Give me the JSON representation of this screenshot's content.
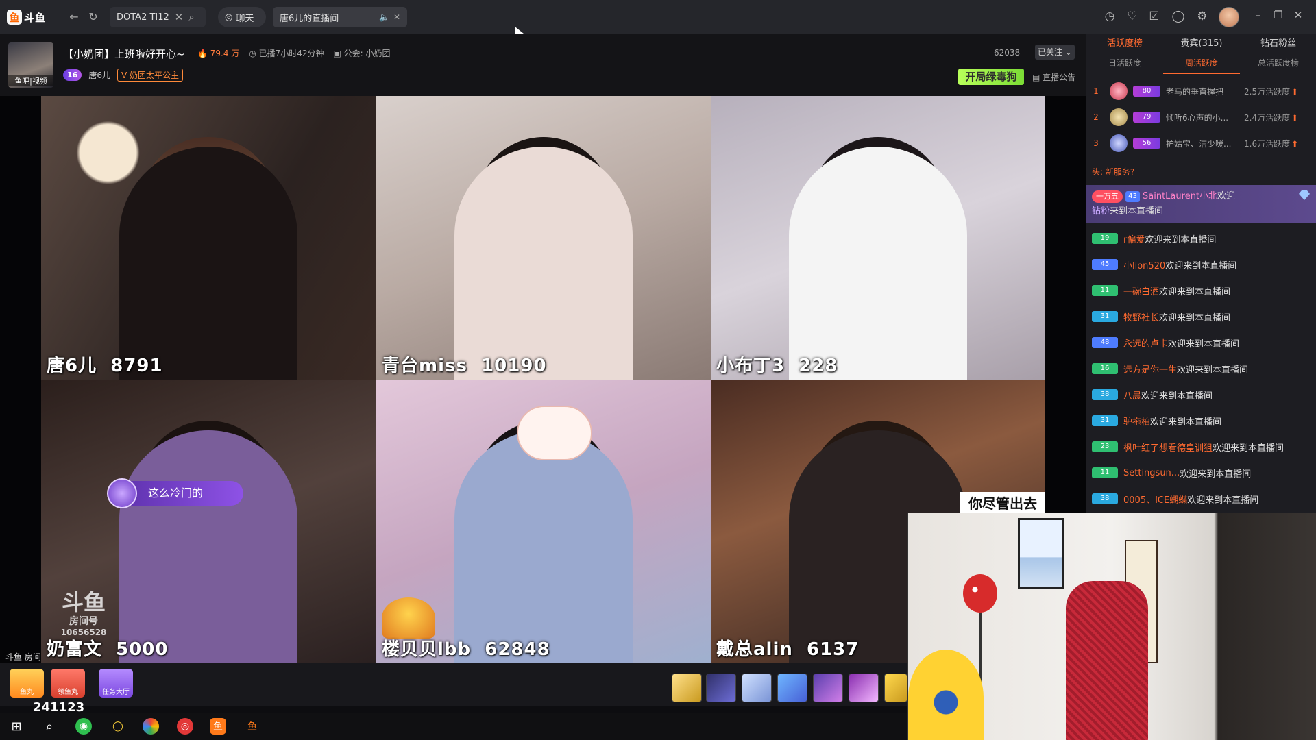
{
  "browser": {
    "logo_text": "斗鱼",
    "tabs": [
      {
        "label": "DOTA2 TI12"
      },
      {
        "label": "聊天"
      },
      {
        "label": "唐6儿的直播间"
      }
    ]
  },
  "room": {
    "avatar_caption": "鱼吧|视频",
    "title": "【小奶团】上班啦好开心~",
    "hot": "79.4 万",
    "duration": "已播7小时42分钟",
    "guild": "公会: 小奶团",
    "anchor_level": "16",
    "anchor_name": "唐6儿",
    "fan_badge": "奶团太平公主",
    "follow_count": "62038",
    "follow_button": "已关注",
    "event_banner": "开局绿毒狗",
    "announcement": "直播公告"
  },
  "streams": [
    {
      "name": "唐6儿",
      "score": "8791"
    },
    {
      "name": "青台miss",
      "score": "10190"
    },
    {
      "name": "小布丁3",
      "score": "228"
    },
    {
      "name": "奶富文",
      "score": "5000"
    },
    {
      "name": "楼贝贝lbb",
      "score": "62848"
    },
    {
      "name": "戴总alin",
      "score": "6137"
    }
  ],
  "overlays": {
    "bubble_text": "这么冷门的",
    "sub_caption": "你尽管出去",
    "watermark_brand": "斗鱼",
    "watermark_label": "房间号",
    "watermark_room": "10656528"
  },
  "side": {
    "tabs": [
      "活跃度榜",
      "贵宾(315)",
      "钻石粉丝"
    ],
    "active_tab": 0,
    "subtabs": [
      "日活跃度",
      "周活跃度",
      "总活跃度榜"
    ],
    "active_subtab": 1,
    "ranking": [
      {
        "rank": "1",
        "level": "80",
        "name": "老马的垂直握把",
        "value": "2.5万活跃度"
      },
      {
        "rank": "2",
        "level": "79",
        "name": "倾听6心声的小...",
        "value": "2.4万活跃度"
      },
      {
        "rank": "3",
        "level": "56",
        "name": "护姑宝、洁少嗳...",
        "value": "1.6万活跃度"
      }
    ],
    "system_tip": "头: 新服务?",
    "vip": {
      "rank_badge": "一万五",
      "level": "43",
      "user": "SaintLaurent小北",
      "text1": "欢迎",
      "role": "钻粉",
      "text2": "来到本直播间"
    },
    "welcome_suffix": "欢迎来到本直播间",
    "welcomes": [
      {
        "level": "19",
        "user": "r偏爱",
        "color": "#2fbf71"
      },
      {
        "level": "45",
        "user": "小lion520",
        "color": "#4e7cff"
      },
      {
        "level": "11",
        "user": "一碗白酒",
        "color": "#2fbf71"
      },
      {
        "level": "31",
        "user": "牧野社长",
        "color": "#2aa9e0"
      },
      {
        "level": "48",
        "user": "永远的卢卡",
        "color": "#4e7cff"
      },
      {
        "level": "16",
        "user": "远方是你一生",
        "color": "#2fbf71"
      },
      {
        "level": "38",
        "user": "八晨",
        "color": "#2aa9e0"
      },
      {
        "level": "31",
        "user": "驴拖柏",
        "color": "#2aa9e0"
      },
      {
        "level": "23",
        "user": "枫叶红了想看德皇训狙",
        "color": "#2fbf71"
      },
      {
        "level": "11",
        "user": "Settingsun...",
        "color": "#2fbf71"
      },
      {
        "level": "38",
        "user": "0005、ICE蝴蝶",
        "color": "#2aa9e0"
      }
    ]
  },
  "bottom": {
    "footer_left": "斗鱼 房间",
    "fish_label": "鱼丸",
    "task_label": "领鱼丸",
    "hall_label": "任务大厅",
    "fishball_count": "241123"
  }
}
